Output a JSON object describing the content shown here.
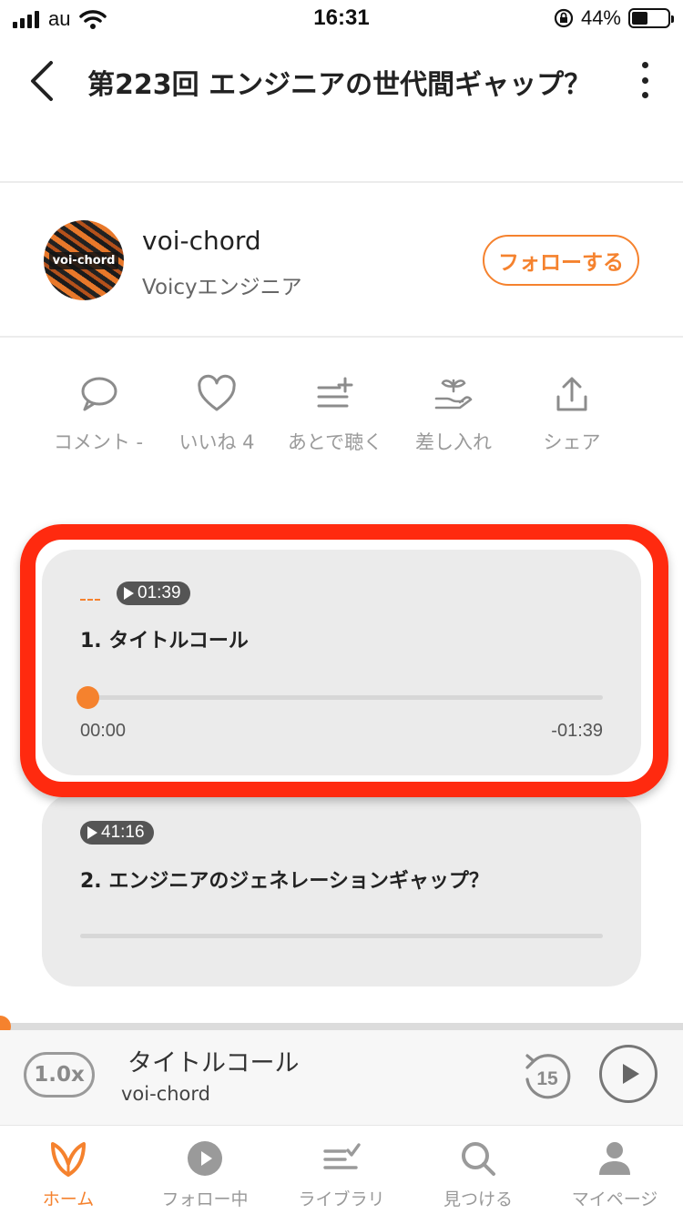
{
  "status_bar": {
    "carrier": "au",
    "time": "16:31",
    "battery_percent": "44%",
    "battery_level": 0.44
  },
  "nav": {
    "title": "第223回 エンジニアの世代間ギャップ？"
  },
  "channel": {
    "name": "voi-chord",
    "subtitle": "Voicyエンジニア",
    "avatar_text": "voi-chord",
    "follow_label": "フォローする"
  },
  "actions": [
    {
      "icon": "comment-icon",
      "label": "コメント -"
    },
    {
      "icon": "heart-icon",
      "label": "いいね 4"
    },
    {
      "icon": "playlist-add-icon",
      "label": "あとで聴く"
    },
    {
      "icon": "gift-hand-icon",
      "label": "差し入れ"
    },
    {
      "icon": "share-icon",
      "label": "シェア"
    }
  ],
  "chapters": [
    {
      "duration": "01:39",
      "title": "1. タイトルコール",
      "current_time": "00:00",
      "remaining_time": "-01:39",
      "progress": 0
    },
    {
      "duration": "41:16",
      "title": "2. エンジニアのジェネレーションギャップ？"
    }
  ],
  "player": {
    "speed": "1.0x",
    "title": "タイトルコール",
    "channel": "voi-chord",
    "rewind_seconds": "15",
    "progress": 0
  },
  "tabs": [
    {
      "icon": "home-logo-icon",
      "label": "ホーム",
      "active": true
    },
    {
      "icon": "play-circle-icon",
      "label": "フォロー中"
    },
    {
      "icon": "library-icon",
      "label": "ライブラリ"
    },
    {
      "icon": "search-icon",
      "label": "見つける"
    },
    {
      "icon": "person-icon",
      "label": "マイページ"
    }
  ],
  "colors": {
    "accent": "#f5822e",
    "highlight": "#ff2a0f",
    "card": "#ebebeb"
  }
}
